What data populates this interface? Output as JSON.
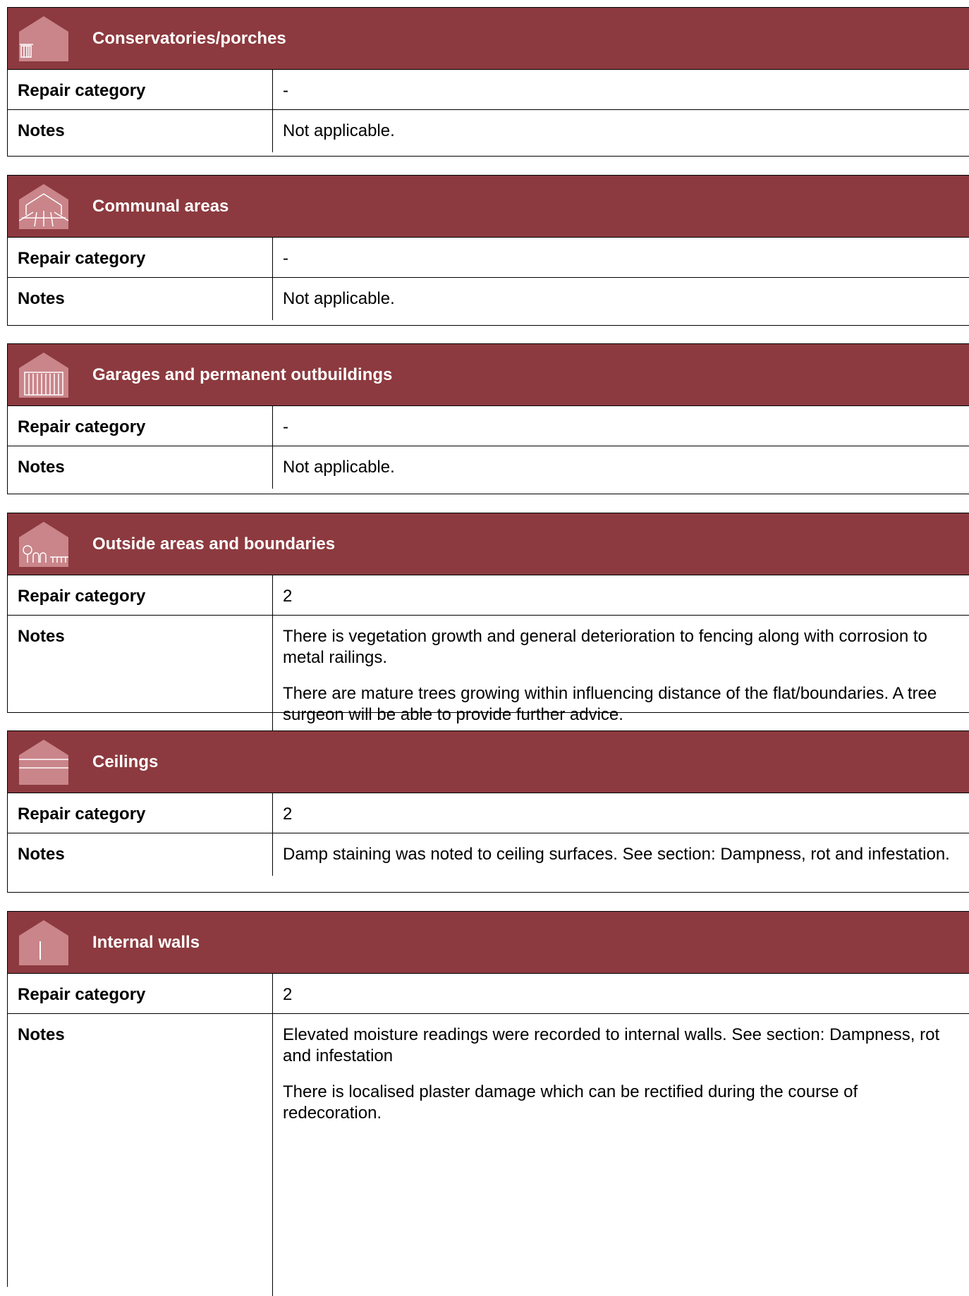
{
  "colors": {
    "header_bg": "#8c3a3f",
    "icon_fill": "#c9858a",
    "header_text": "#ffffff"
  },
  "labels": {
    "repair_category": "Repair category",
    "notes": "Notes"
  },
  "sections": [
    {
      "icon": "conservatory-icon",
      "title": "Conservatories/porches",
      "repair_category": "-",
      "notes": [
        "Not applicable."
      ]
    },
    {
      "icon": "communal-areas-icon",
      "title": "Communal areas",
      "repair_category": "-",
      "notes": [
        "Not applicable."
      ]
    },
    {
      "icon": "garage-icon",
      "title": "Garages and permanent outbuildings",
      "repair_category": "-",
      "notes": [
        "Not applicable."
      ]
    },
    {
      "icon": "outside-areas-icon",
      "title": "Outside areas and boundaries",
      "repair_category": "2",
      "notes": [
        "There is vegetation growth and general deterioration to fencing along with corrosion to metal railings.",
        "There are mature trees growing within influencing distance of the flat/boundaries. A tree surgeon will be able to provide further advice."
      ]
    },
    {
      "icon": "ceilings-icon",
      "title": "Ceilings",
      "repair_category": "2",
      "notes": [
        "Damp staining was noted to ceiling surfaces. See section: Dampness, rot and infestation."
      ]
    },
    {
      "icon": "internal-walls-icon",
      "title": "Internal walls",
      "repair_category": "2",
      "notes": [
        "Elevated moisture readings were recorded to internal walls. See section: Dampness, rot and infestation",
        "There is localised plaster damage which can be rectified during the course of redecoration."
      ]
    }
  ]
}
